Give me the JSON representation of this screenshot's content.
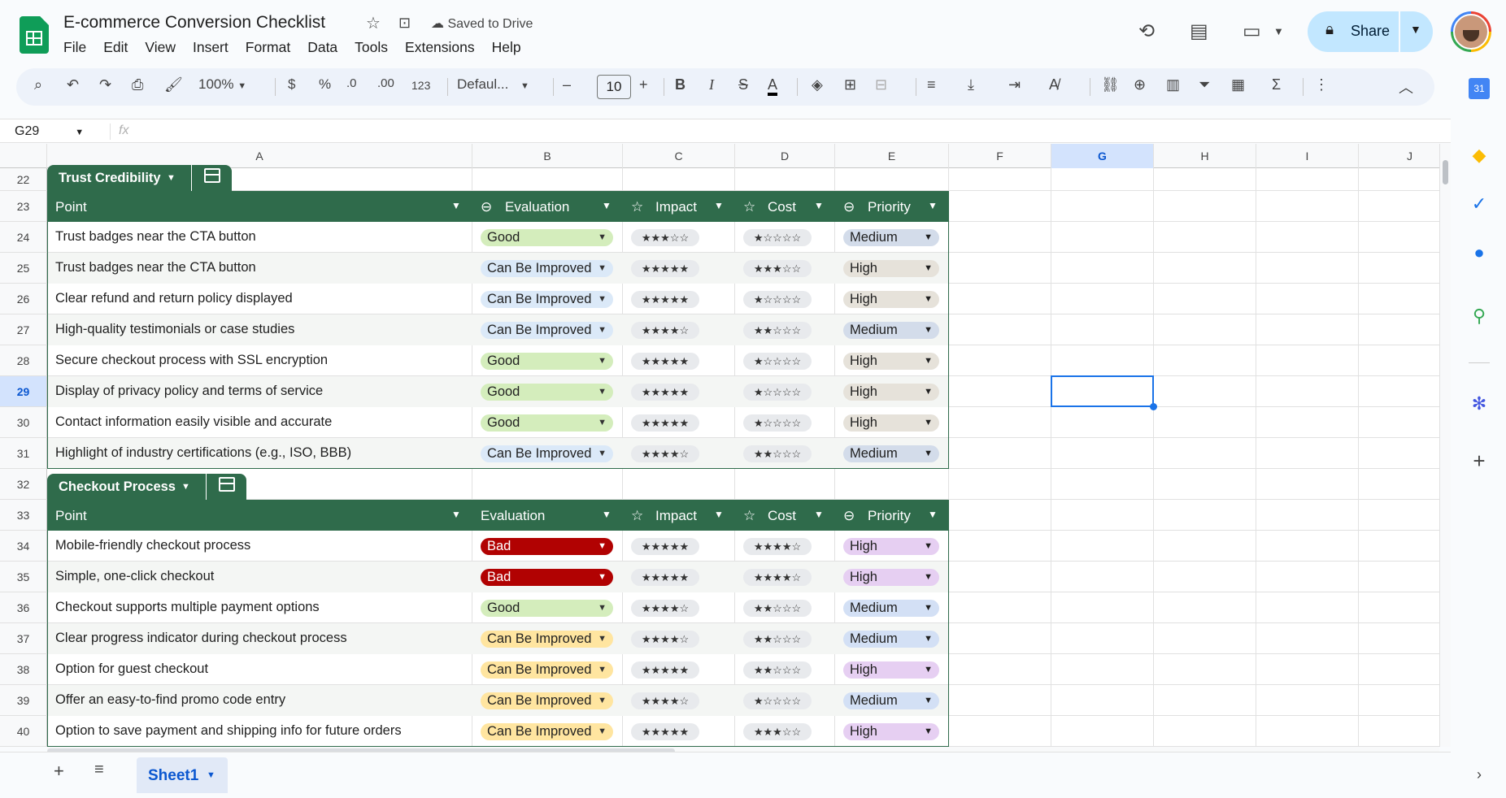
{
  "app": {
    "title": "E-commerce Conversion Checklist",
    "saved_status": "Saved to Drive",
    "menu": [
      "File",
      "Edit",
      "View",
      "Insert",
      "Format",
      "Data",
      "Tools",
      "Extensions",
      "Help"
    ],
    "share_label": "Share"
  },
  "toolbar": {
    "zoom": "100%",
    "currency": "$",
    "percent": "%",
    "dec_decrease": ".0",
    "dec_increase": ".00",
    "number_format": "123",
    "font": "Defaul...",
    "font_size": "10"
  },
  "formula_bar": {
    "cell_ref": "G29",
    "fx": "fx",
    "value": ""
  },
  "columns": [
    "A",
    "B",
    "C",
    "D",
    "E",
    "F",
    "G",
    "H",
    "I",
    "J"
  ],
  "selected_cell": "G29",
  "tables": [
    {
      "name": "Trust Credibility",
      "header_row": 23,
      "name_row": 22,
      "headers": [
        "Point",
        "Evaluation",
        "Impact",
        "Cost",
        "Priority"
      ],
      "rows": [
        {
          "row": 24,
          "point": "Trust badges near the CTA button",
          "evaluation": "Good",
          "impact": "★★★☆☆",
          "cost": "★☆☆☆☆",
          "priority": "Medium"
        },
        {
          "row": 25,
          "point": "Trust badges near the CTA button",
          "evaluation": "Can Be Improved",
          "impact": "★★★★★",
          "cost": "★★★☆☆",
          "priority": "High"
        },
        {
          "row": 26,
          "point": "Clear refund and return policy displayed",
          "evaluation": "Can Be Improved",
          "impact": "★★★★★",
          "cost": "★☆☆☆☆",
          "priority": "High"
        },
        {
          "row": 27,
          "point": "High-quality testimonials or case studies",
          "evaluation": "Can Be Improved",
          "impact": "★★★★☆",
          "cost": "★★☆☆☆",
          "priority": "Medium"
        },
        {
          "row": 28,
          "point": "Secure checkout process with SSL encryption",
          "evaluation": "Good",
          "impact": "★★★★★",
          "cost": "★☆☆☆☆",
          "priority": "High"
        },
        {
          "row": 29,
          "point": "Display of privacy policy and terms of service",
          "evaluation": "Good",
          "impact": "★★★★★",
          "cost": "★☆☆☆☆",
          "priority": "High"
        },
        {
          "row": 30,
          "point": "Contact information easily visible and accurate",
          "evaluation": "Good",
          "impact": "★★★★★",
          "cost": "★☆☆☆☆",
          "priority": "High"
        },
        {
          "row": 31,
          "point": "Highlight of industry certifications (e.g., ISO, BBB)",
          "evaluation": "Can Be Improved",
          "impact": "★★★★☆",
          "cost": "★★☆☆☆",
          "priority": "Medium"
        }
      ]
    },
    {
      "name": "Checkout Process",
      "header_row": 33,
      "name_row": 32,
      "headers": [
        "Point",
        "Evaluation",
        "Impact",
        "Cost",
        "Priority"
      ],
      "rows": [
        {
          "row": 34,
          "point": "Mobile-friendly checkout process",
          "evaluation": "Bad",
          "impact": "★★★★★",
          "cost": "★★★★☆",
          "priority": "High"
        },
        {
          "row": 35,
          "point": "Simple, one-click checkout",
          "evaluation": "Bad",
          "impact": "★★★★★",
          "cost": "★★★★☆",
          "priority": "High"
        },
        {
          "row": 36,
          "point": "Checkout supports multiple payment options",
          "evaluation": "Good",
          "impact": "★★★★☆",
          "cost": "★★☆☆☆",
          "priority": "Medium"
        },
        {
          "row": 37,
          "point": "Clear progress indicator during checkout process",
          "evaluation": "Can Be Improved",
          "impact": "★★★★☆",
          "cost": "★★☆☆☆",
          "priority": "Medium"
        },
        {
          "row": 38,
          "point": "Option for guest checkout",
          "evaluation": "Can Be Improved",
          "impact": "★★★★★",
          "cost": "★★☆☆☆",
          "priority": "High"
        },
        {
          "row": 39,
          "point": "Offer an easy-to-find promo code entry",
          "evaluation": "Can Be Improved",
          "impact": "★★★★☆",
          "cost": "★☆☆☆☆",
          "priority": "Medium"
        },
        {
          "row": 40,
          "point": "Option to save payment and shipping info for future orders",
          "evaluation": "Can Be Improved",
          "impact": "★★★★★",
          "cost": "★★★☆☆",
          "priority": "High"
        }
      ]
    }
  ],
  "chip_colors": {
    "Good": "#d4edbc",
    "Bad": "#b10202",
    "Can Be Improved (table1)": "#dbe9f8",
    "Can Be Improved (table2)": "#ffe5a0",
    "Medium": "#d3dcea",
    "High (table1)": "#e6e2da",
    "High (table2)": "#e6cff2",
    "Medium (table2)": "#d3e0f5",
    "header_green": "#2f6b4b"
  },
  "sheets": [
    "Sheet1"
  ]
}
